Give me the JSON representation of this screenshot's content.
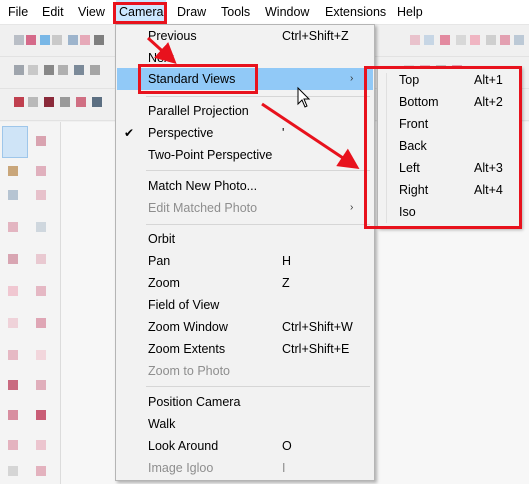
{
  "menubar": {
    "items": [
      "File",
      "Edit",
      "View",
      "Camera",
      "Draw",
      "Tools",
      "Window",
      "Extensions",
      "Help"
    ],
    "active": "Camera"
  },
  "camera_menu": {
    "previous": {
      "label": "Previous",
      "shortcut": "Ctrl+Shift+Z"
    },
    "next": {
      "label": "Next"
    },
    "standard_views": {
      "label": "Standard Views",
      "arrow": "›"
    },
    "parallel_projection": {
      "label": "Parallel Projection"
    },
    "perspective": {
      "label": "Perspective",
      "check": "✔",
      "shortcut": "'"
    },
    "two_point_perspective": {
      "label": "Two-Point Perspective"
    },
    "match_new_photo": {
      "label": "Match New Photo..."
    },
    "edit_matched_photo": {
      "label": "Edit Matched Photo",
      "arrow": "›"
    },
    "orbit": {
      "label": "Orbit"
    },
    "pan": {
      "label": "Pan",
      "shortcut": "H"
    },
    "zoom": {
      "label": "Zoom",
      "shortcut": "Z"
    },
    "field_of_view": {
      "label": "Field of View"
    },
    "zoom_window": {
      "label": "Zoom Window",
      "shortcut": "Ctrl+Shift+W"
    },
    "zoom_extents": {
      "label": "Zoom Extents",
      "shortcut": "Ctrl+Shift+E"
    },
    "zoom_to_photo": {
      "label": "Zoom to Photo"
    },
    "position_camera": {
      "label": "Position Camera"
    },
    "walk": {
      "label": "Walk"
    },
    "look_around": {
      "label": "Look Around",
      "shortcut": "O"
    },
    "image_igloo": {
      "label": "Image Igloo",
      "shortcut": "I"
    }
  },
  "standard_views_submenu": {
    "top": {
      "label": "Top",
      "shortcut": "Alt+1"
    },
    "bottom": {
      "label": "Bottom",
      "shortcut": "Alt+2"
    },
    "front": {
      "label": "Front"
    },
    "back": {
      "label": "Back"
    },
    "left": {
      "label": "Left",
      "shortcut": "Alt+3"
    },
    "right": {
      "label": "Right",
      "shortcut": "Alt+4"
    },
    "iso": {
      "label": "Iso"
    }
  },
  "colors": {
    "highlight": "#91c9f7",
    "menubar_active": "#cce8ff",
    "annotation_red": "#e8121d",
    "disabled_text": "#8e8e8e"
  }
}
